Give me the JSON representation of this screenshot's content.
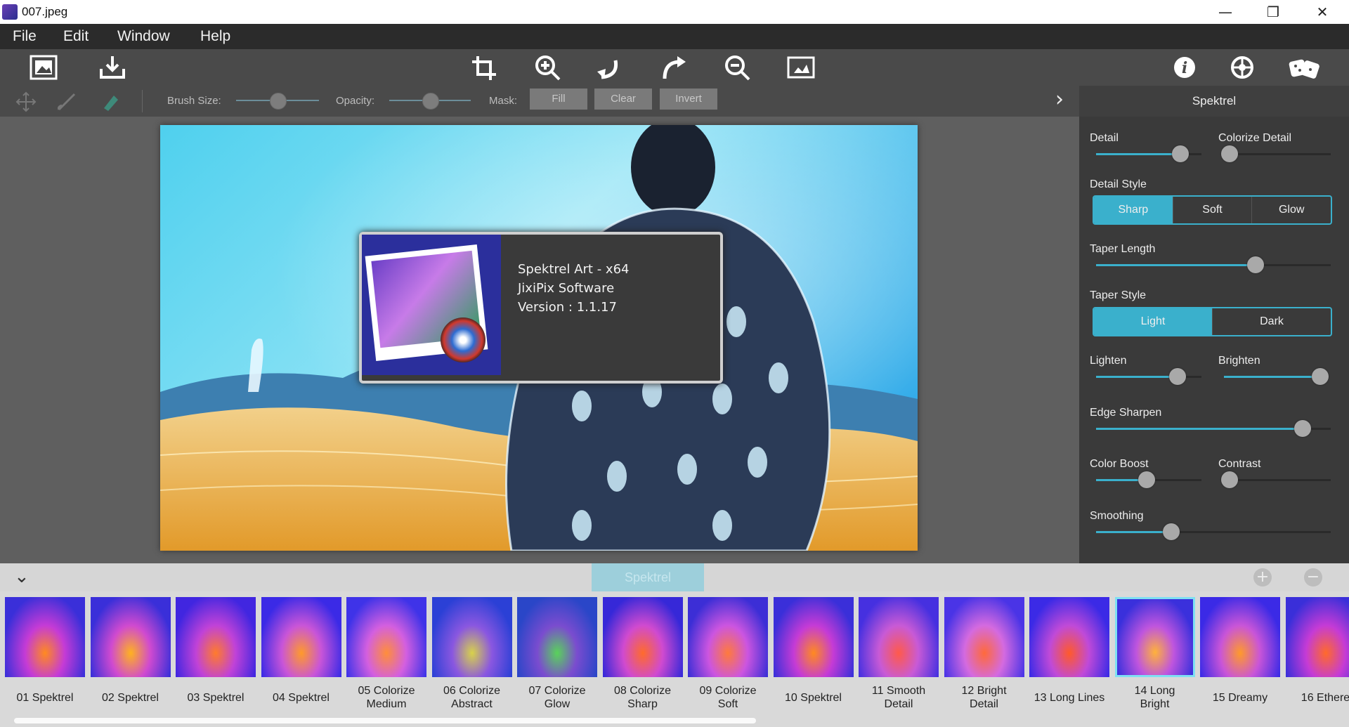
{
  "window": {
    "title": "007.jpeg",
    "minimize": "—",
    "restore": "❐",
    "close": "✕"
  },
  "menu": [
    "File",
    "Edit",
    "Window",
    "Help"
  ],
  "toolbar": {
    "icons": [
      "open-image-icon",
      "save-icon",
      "crop-icon",
      "zoom-in-icon",
      "rotate-left-icon",
      "rotate-right-icon",
      "zoom-out-icon",
      "fit-screen-icon",
      "info-icon",
      "settings-icon",
      "random-dice-icon"
    ]
  },
  "mask_toolbar": {
    "brush_size_label": "Brush Size:",
    "brush_size_value": 0.5,
    "opacity_label": "Opacity:",
    "opacity_value": 0.5,
    "mask_label": "Mask:",
    "fill": "Fill",
    "clear": "Clear",
    "invert": "Invert",
    "expand_arrow": "›"
  },
  "panel": {
    "title": "Spektrel",
    "detail": {
      "label": "Detail",
      "value": 0.8
    },
    "colorize_detail": {
      "label": "Colorize Detail",
      "value": 0.05
    },
    "detail_style": {
      "label": "Detail Style",
      "options": [
        "Sharp",
        "Soft",
        "Glow"
      ],
      "selected": "Sharp"
    },
    "taper_length": {
      "label": "Taper Length",
      "value": 0.68
    },
    "taper_style": {
      "label": "Taper Style",
      "options": [
        "Light",
        "Dark"
      ],
      "selected": "Light"
    },
    "lighten": {
      "label": "Lighten",
      "value": 0.77
    },
    "brighten": {
      "label": "Brighten",
      "value": 0.98
    },
    "edge_sharpen": {
      "label": "Edge Sharpen",
      "value": 0.88
    },
    "color_boost": {
      "label": "Color Boost",
      "value": 0.48
    },
    "contrast": {
      "label": "Contrast",
      "value": 0.05
    },
    "smoothing": {
      "label": "Smoothing",
      "value": 0.32
    }
  },
  "about": {
    "line1": "Spektrel Art - x64",
    "line2": "JixiPix Software",
    "line3": "Version : 1.1.17"
  },
  "presets": {
    "collection": "Spektrel",
    "collapse": "⌄",
    "add": "+",
    "remove": "−",
    "selected": "14 Long\nBright",
    "items": [
      "01 Spektrel",
      "02 Spektrel",
      "03 Spektrel",
      "04 Spektrel",
      "05 Colorize\nMedium",
      "06 Colorize\nAbstract",
      "07 Colorize\nGlow",
      "08 Colorize\nSharp",
      "09 Colorize\nSoft",
      "10 Spektrel",
      "11 Smooth\nDetail",
      "12 Bright\nDetail",
      "13 Long Lines",
      "14 Long\nBright",
      "15 Dreamy",
      "16 Ethere"
    ]
  }
}
